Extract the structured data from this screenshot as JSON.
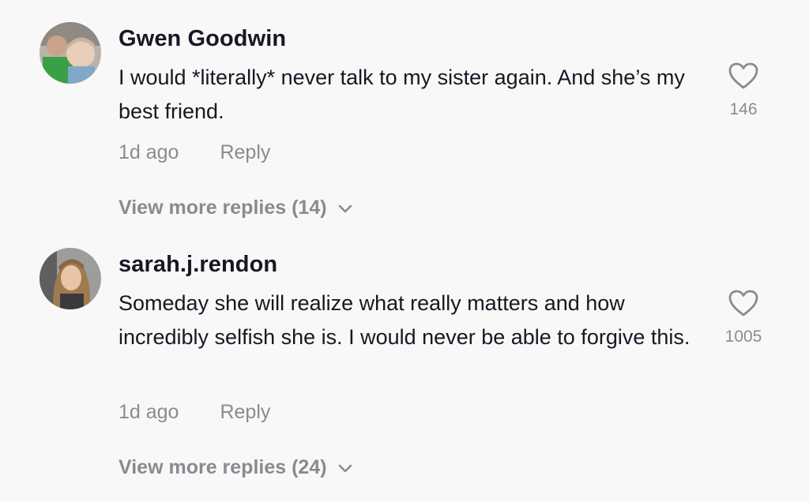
{
  "comments": [
    {
      "username": "Gwen Goodwin",
      "text": "I would *literally* never talk to my sister again. And she’s my best friend.",
      "time": "1d ago",
      "reply_label": "Reply",
      "likes": "146",
      "view_more": "View more replies (14)",
      "avatar_icon": "avatar-photo"
    },
    {
      "username": "sarah.j.rendon",
      "text": "Someday she will realize what really matters and how incredibly selfish she is. I would never be able to forgive this.",
      "time": "1d ago",
      "reply_label": "Reply",
      "likes": "1005",
      "view_more": "View more replies (24)",
      "avatar_icon": "avatar-photo"
    }
  ],
  "colors": {
    "background": "#f8f8f8",
    "text_primary": "#161823",
    "text_secondary": "#8a8b91"
  }
}
